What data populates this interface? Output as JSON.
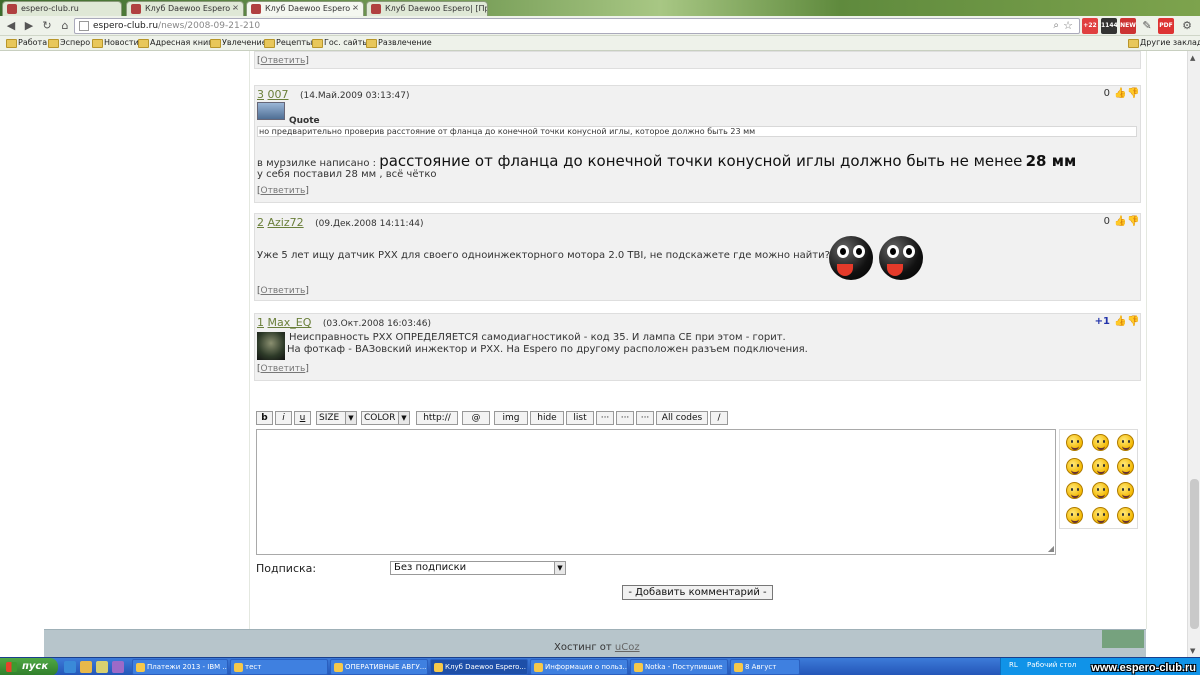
{
  "browser": {
    "tabs": [
      {
        "label": "espero-club.ru",
        "active": false
      },
      {
        "label": "Клуб Daewoo Espero -",
        "active": false
      },
      {
        "label": "Клуб Daewoo Espero -",
        "active": true
      },
      {
        "label": "Клуб Daewoo Espero| [При",
        "active": false
      }
    ],
    "url_host": "espero-club.ru",
    "url_path": "/news/2008-09-21-210",
    "extensions": [
      "+22",
      "1144",
      "NEW",
      "PDF"
    ],
    "bookmarks": [
      "Работа",
      "Эсперо",
      "Новости",
      "Адресная книга",
      "Увлечение",
      "Рецепты",
      "Гос. сайты",
      "Развлечение"
    ],
    "other_bookmarks": "Другие закладки"
  },
  "comments": {
    "top_reply": "Ответить",
    "c3": {
      "num": "3",
      "user": "007",
      "date": "(14.Май.2009 03:13:47)",
      "rating": "0",
      "quote_label": "Quote",
      "quote_text": "но предварительно проверив расстояние от фланца до конечной точки конусной иглы, которое должно быть 23 мм",
      "line1_prefix": "в мурзилке написано :",
      "line1_big": "расстояние от фланца до конечной точки конусной иглы должно быть не менее",
      "line1_big2": "28 мм",
      "line2": "у себя поставил 28 мм , всё чётко",
      "reply": "Ответить"
    },
    "c2": {
      "num": "2",
      "user": "Aziz72",
      "date": "(09.Дек.2008 14:11:44)",
      "rating": "0",
      "text": "Уже 5 лет ищу датчик РХХ для своего одноинжекторного мотора 2.0 TBI, не подскажете где можно найти?",
      "reply": "Ответить"
    },
    "c1": {
      "num": "1",
      "user": "Max_EQ",
      "date": "(03.Окт.2008 16:03:46)",
      "rating": "+1",
      "line1": "Неисправность РХХ ОПРЕДЕЛЯЕТСЯ самодиагностикой - код 35. И лампа СЕ при этом - горит.",
      "line2": "На фоткаф - ВАЗовский инжектор и РХХ. На Espero по другому расположен разъем подключения.",
      "reply": "Ответить"
    }
  },
  "form": {
    "bbcode": [
      "b",
      "i",
      "u",
      "SIZE",
      "COLOR",
      "http://",
      "@",
      "img",
      "hide",
      "list",
      "···",
      "···",
      "···",
      "All codes",
      "/"
    ],
    "subscription_label": "Подписка:",
    "subscription_value": "Без подписки",
    "submit": "- Добавить комментарий -"
  },
  "footer": {
    "hosting_prefix": "Хостинг от",
    "hosting_link": "uCoz"
  },
  "taskbar": {
    "start": "пуск",
    "items": [
      "Платежи 2013 - IBM ...",
      "тест",
      "ОПЕРАТИВНЫЕ АВГУ...",
      "Клуб Daewoo Espero...",
      "Информация о польз...",
      "Notka - Поступившие",
      "8 Август"
    ],
    "lang": "RL",
    "desktop": "Рабочий стол"
  },
  "watermark": "www.espero-club.ru"
}
